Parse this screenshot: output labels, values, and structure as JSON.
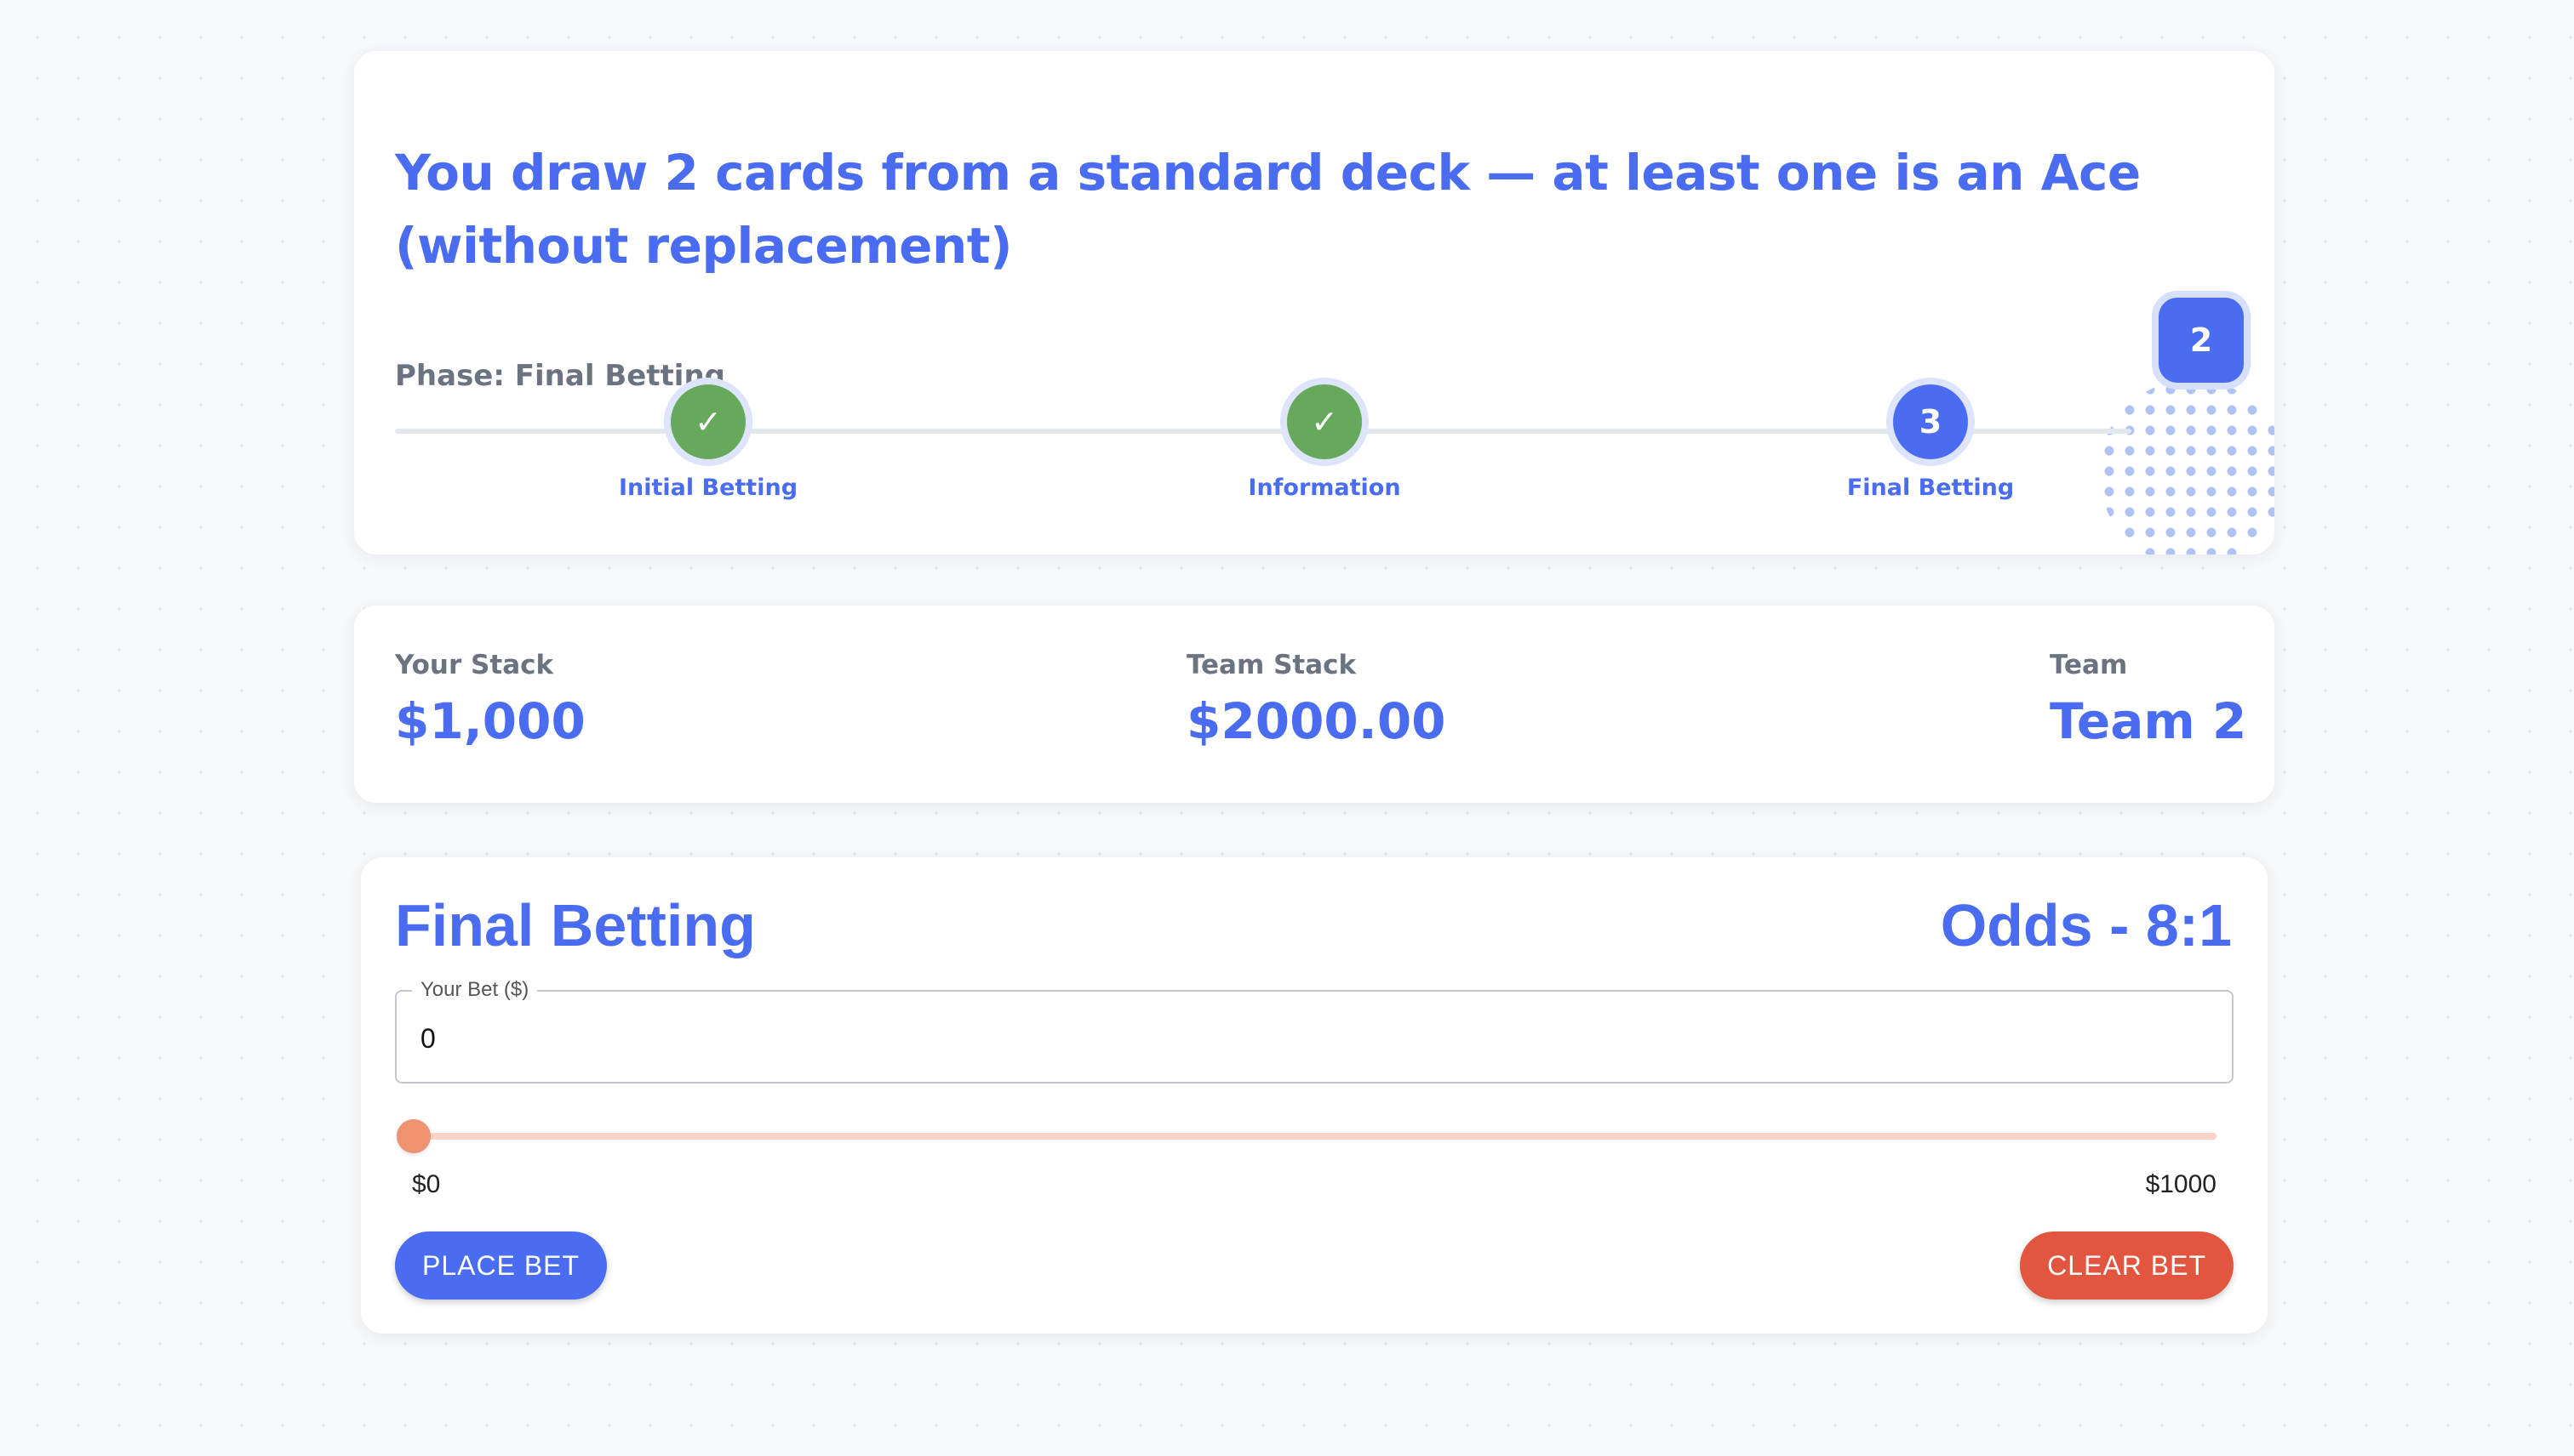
{
  "question": {
    "title": "You draw 2 cards from a standard deck — at least one is an Ace (without replacement)",
    "phase_text": "Phase: Final Betting",
    "team_badge": "2",
    "steps": [
      {
        "label": "Initial Betting",
        "marker": "✓",
        "state": "done"
      },
      {
        "label": "Information",
        "marker": "✓",
        "state": "done"
      },
      {
        "label": "Final Betting",
        "marker": "3",
        "state": "active"
      }
    ]
  },
  "stats": {
    "your_stack": {
      "label": "Your Stack",
      "value": "$1,000"
    },
    "team_stack": {
      "label": "Team Stack",
      "value": "$2000.00"
    },
    "team": {
      "label": "Team",
      "value": "Team 2"
    }
  },
  "betting": {
    "title": "Final Betting",
    "odds": "Odds - 8:1",
    "field_label": "Your Bet ($)",
    "bet_value": "0",
    "slider": {
      "min_label": "$0",
      "max_label": "$1000",
      "min": 0,
      "max": 1000,
      "value": 0
    },
    "place_label": "PLACE BET",
    "clear_label": "CLEAR BET"
  },
  "colors": {
    "accent": "#4a6cf0",
    "done": "#67a95a",
    "slider": "#ee9270",
    "danger": "#e25640"
  }
}
